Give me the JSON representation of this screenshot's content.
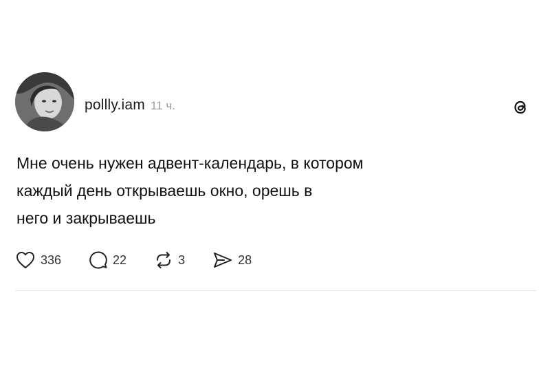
{
  "post": {
    "username": "pollly.iam",
    "timestamp": "11 ч.",
    "text": "Мне очень нужен адвент-календарь, в котором\nкаждый день открываешь окно, орешь в\nнего и закрываешь"
  },
  "actions": {
    "likes": "336",
    "replies": "22",
    "reposts": "3",
    "shares": "28"
  },
  "icons": {
    "like": "heart-icon",
    "reply": "comment-icon",
    "repost": "repost-icon",
    "share": "send-icon",
    "brand": "threads-logo-icon"
  }
}
